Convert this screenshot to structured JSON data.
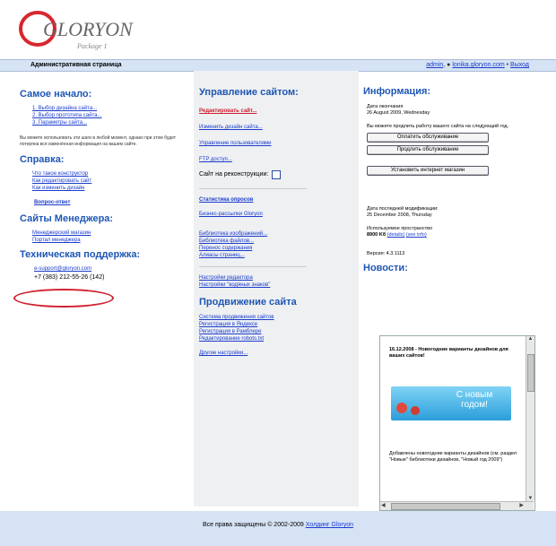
{
  "logo": {
    "text": "GLORYON",
    "sub": "Package 1"
  },
  "topbar": {
    "title": "Административная страница",
    "user": "admin",
    "site": "lonika.gloryon.com",
    "logout": "Выход"
  },
  "left": {
    "start": {
      "heading": "Самое начало:",
      "items": [
        "1.  Выбор дизайна сайта...",
        "2.  Выбор прототипа сайта...",
        "3.  Параметры сайта..."
      ],
      "note": "Вы можете использовать эти шаги в любой момент, однако при этом будет потеряна вся изменённая информация на вашем сайте."
    },
    "help": {
      "heading": "Справка:",
      "links": [
        "Что такое конструктор",
        "Как редактировать сайт",
        "Как изменить дизайн"
      ],
      "qa": "Вопрос-ответ"
    },
    "manager": {
      "heading": "Сайты Менеджера:",
      "links": [
        "Менеджерский магазин",
        "Портал менеджера"
      ]
    },
    "support": {
      "heading": "Техническая поддержка:",
      "email": "e-support@gloryon.com",
      "phone": "+7 (383) 212-55-26 (142)"
    }
  },
  "middle": {
    "manage": {
      "heading": "Управление сайтом:",
      "edit": "Редактировать сайт...",
      "links": [
        "Изменить дизайн сайта...",
        "Управление пользователями",
        "FTP доступ..."
      ],
      "reconstruction": "Сайт на реконструкции:"
    },
    "stats": {
      "title": "Статистика опросов",
      "mailing": "Бизнес-рассылки Gloryon"
    },
    "libs": [
      "Библиотека изображений...",
      "Библиотека файлов...",
      "Перенос содержания",
      "Алиасы страниц..."
    ],
    "settings": [
      "Настройки редактора",
      "Настройки \"водяных знаков\""
    ],
    "promo": {
      "heading": "Продвижение сайта",
      "links": [
        "Система продвижения сайтов",
        "Регистрация в Яндексе",
        "Регистрация в Рамблере",
        "Редактирование robots.txt"
      ],
      "other": "Другие настройки..."
    }
  },
  "right": {
    "info": {
      "heading": "Информация:",
      "paid_label": "Дата окончания",
      "paid_date": "26 August 2009, Wednesday",
      "extend_text": "Вы можете продлить работу вашего сайта на следующий год.",
      "btn_pay": "Оплатить обслуживание",
      "btn_extend": "Продлить обслуживание",
      "btn_shop": "Установить интернет магазин",
      "modified_label": "Дата последней модификации:",
      "modified_date": "25 December 2008, Thursday",
      "space_label": "Используемое пространство",
      "space_value": "8900 Kб",
      "space_link1": "(details)",
      "space_link2": "(see info)",
      "version": "Версия: 4.3.1113"
    },
    "news": {
      "heading": "Новости:",
      "title": "16.12.2008 - Новогодние варианты дизайнов для ваших сайтов!",
      "banner1": "С новым",
      "banner2": "годом!",
      "body": "Добавлены новогодние варианты дизайнов (см. раздел \"Новые\" библиотеки дизайнов, \"Новый год 2009\")"
    }
  },
  "footer": {
    "text": "Все права защищены © 2002-2009",
    "link": "Холдинг Gloryon"
  }
}
